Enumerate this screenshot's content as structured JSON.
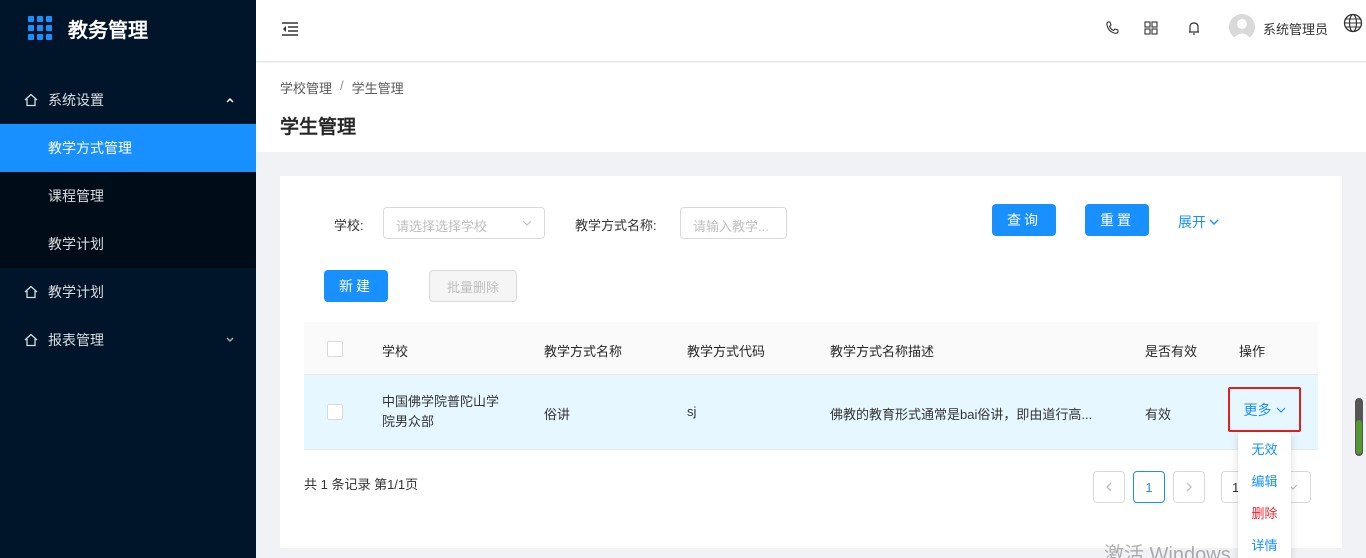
{
  "app": {
    "title": "教务管理"
  },
  "sidebar": {
    "items": [
      {
        "label": "系统设置",
        "icon": "home-icon",
        "expanded": true
      },
      {
        "label": "教学方式管理",
        "active": true
      },
      {
        "label": "课程管理"
      },
      {
        "label": "教学计划"
      },
      {
        "label": "教学计划",
        "icon": "home-icon"
      },
      {
        "label": "报表管理",
        "icon": "home-icon",
        "expanded": false
      }
    ]
  },
  "header": {
    "username": "系统管理员"
  },
  "breadcrumb": {
    "parent": "学校管理",
    "separator": "/",
    "current": "学生管理"
  },
  "page": {
    "title": "学生管理"
  },
  "filters": {
    "school_label": "学校:",
    "school_placeholder": "请选择选择学校",
    "method_label": "教学方式名称:",
    "method_placeholder": "请输入教学...",
    "query_label": "查询",
    "reset_label": "重置",
    "expand_label": "展开"
  },
  "actions": {
    "new_label": "新建",
    "batch_delete_label": "批量删除"
  },
  "table": {
    "columns": [
      "学校",
      "教学方式名称",
      "教学方式代码",
      "教学方式名称描述",
      "是否有效",
      "操作"
    ],
    "rows": [
      {
        "school_line1": "中国佛学院普陀山学",
        "school_line2": "院男众部",
        "method": "俗讲",
        "code": "sj",
        "desc": "佛教的教育形式通常是bai俗讲，即由道行高...",
        "valid": "有效",
        "op": "更多"
      }
    ]
  },
  "pagination": {
    "total_text": "共 1 条记录 第1/1页",
    "current_page": "1",
    "page_size_text": "1"
  },
  "dropdown": {
    "items": [
      "无效",
      "编辑",
      "删除",
      "详情"
    ]
  },
  "watermark": "激活 Windows",
  "colors": {
    "primary": "#1890ff",
    "sidebar": "#001529",
    "danger": "#f5222d",
    "highlight": "#e02020"
  }
}
